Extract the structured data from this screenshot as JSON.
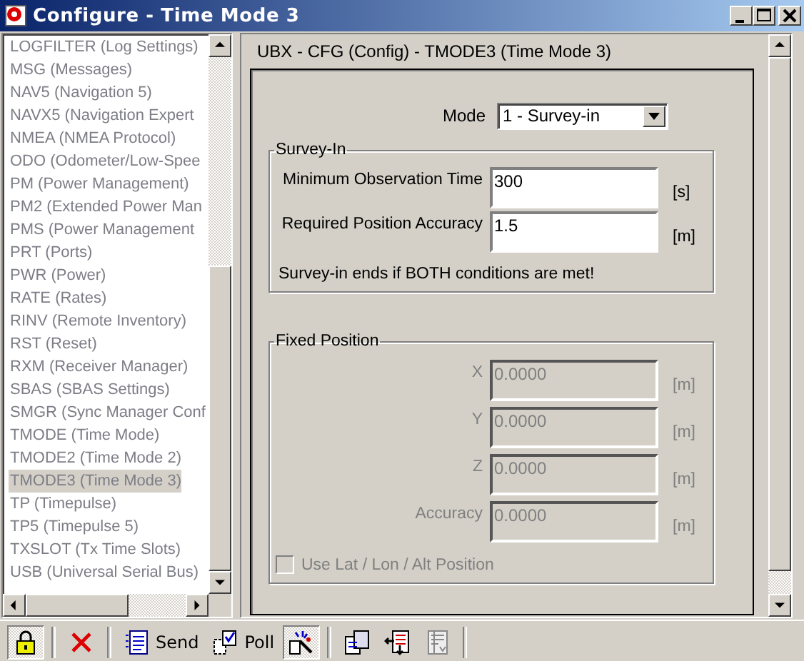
{
  "window": {
    "title": "Configure - Time Mode 3"
  },
  "sidebar": {
    "items": [
      {
        "label": "LOGFILTER (Log Settings)",
        "selected": false
      },
      {
        "label": "MSG (Messages)",
        "selected": false
      },
      {
        "label": "NAV5 (Navigation 5)",
        "selected": false
      },
      {
        "label": "NAVX5 (Navigation Expert",
        "selected": false
      },
      {
        "label": "NMEA (NMEA Protocol)",
        "selected": false
      },
      {
        "label": "ODO (Odometer/Low-Spee",
        "selected": false
      },
      {
        "label": "PM (Power Management)",
        "selected": false
      },
      {
        "label": "PM2 (Extended Power Man",
        "selected": false
      },
      {
        "label": "PMS (Power Management",
        "selected": false
      },
      {
        "label": "PRT (Ports)",
        "selected": false
      },
      {
        "label": "PWR (Power)",
        "selected": false
      },
      {
        "label": "RATE (Rates)",
        "selected": false
      },
      {
        "label": "RINV (Remote Inventory)",
        "selected": false
      },
      {
        "label": "RST (Reset)",
        "selected": false
      },
      {
        "label": "RXM (Receiver Manager)",
        "selected": false
      },
      {
        "label": "SBAS (SBAS Settings)",
        "selected": false
      },
      {
        "label": "SMGR (Sync Manager Conf",
        "selected": false
      },
      {
        "label": "TMODE (Time Mode)",
        "selected": false
      },
      {
        "label": "TMODE2 (Time Mode 2)",
        "selected": false
      },
      {
        "label": "TMODE3 (Time Mode 3)",
        "selected": true
      },
      {
        "label": "TP (Timepulse)",
        "selected": false
      },
      {
        "label": "TP5 (Timepulse 5)",
        "selected": false
      },
      {
        "label": "TXSLOT (Tx Time Slots)",
        "selected": false
      },
      {
        "label": "USB (Universal Serial Bus)",
        "selected": false
      }
    ]
  },
  "panel": {
    "header": "UBX - CFG (Config) - TMODE3 (Time Mode 3)",
    "mode": {
      "label": "Mode",
      "value": "1 - Survey-in"
    },
    "survey_in": {
      "title": "Survey-In",
      "disabled": false,
      "fields": [
        {
          "label": "Minimum Observation Time",
          "value": "300",
          "unit": "[s]"
        },
        {
          "label": "Required Position Accuracy",
          "value": "1.5",
          "unit": "[m]"
        }
      ],
      "note": "Survey-in ends if BOTH conditions are met!"
    },
    "fixed_position": {
      "title": "Fixed Position",
      "disabled": true,
      "fields": [
        {
          "label": "X",
          "value": "0.0000",
          "unit": "[m]"
        },
        {
          "label": "Y",
          "value": "0.0000",
          "unit": "[m]"
        },
        {
          "label": "Z",
          "value": "0.0000",
          "unit": "[m]"
        },
        {
          "label": "Accuracy",
          "value": "0.0000",
          "unit": "[m]"
        }
      ],
      "checkbox": {
        "label": "Use Lat / Lon / Alt Position",
        "checked": false,
        "disabled": true
      }
    }
  },
  "toolbar": [
    {
      "kind": "lock",
      "pressed": true
    },
    {
      "kind": "separator"
    },
    {
      "kind": "delete",
      "pressed": false
    },
    {
      "kind": "separator"
    },
    {
      "kind": "send",
      "label": "Send",
      "pressed": false
    },
    {
      "kind": "poll",
      "label": "Poll",
      "pressed": false
    },
    {
      "kind": "wand",
      "pressed": true
    },
    {
      "kind": "separator"
    },
    {
      "kind": "copy",
      "pressed": false
    },
    {
      "kind": "load",
      "pressed": false
    },
    {
      "kind": "sheet",
      "pressed": false
    },
    {
      "kind": "separator"
    }
  ]
}
